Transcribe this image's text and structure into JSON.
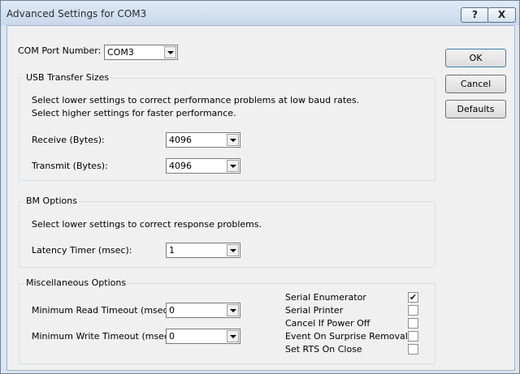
{
  "window": {
    "title": "Advanced Settings for COM3",
    "help_label": "?",
    "close_label": "X"
  },
  "com_port": {
    "label": "COM Port Number:",
    "value": "COM3"
  },
  "buttons": {
    "ok": "OK",
    "cancel": "Cancel",
    "defaults": "Defaults"
  },
  "usb": {
    "legend": "USB Transfer Sizes",
    "desc1": "Select lower settings to correct performance problems at low baud rates.",
    "desc2": "Select higher settings for faster performance.",
    "receive_label": "Receive (Bytes):",
    "receive_value": "4096",
    "transmit_label": "Transmit (Bytes):",
    "transmit_value": "4096"
  },
  "bm": {
    "legend": "BM Options",
    "desc": "Select lower settings to correct response problems.",
    "latency_label": "Latency Timer (msec):",
    "latency_value": "1"
  },
  "misc": {
    "legend": "Miscellaneous Options",
    "read_timeout_label": "Minimum Read Timeout (msec):",
    "read_timeout_value": "0",
    "write_timeout_label": "Minimum Write Timeout (msec):",
    "write_timeout_value": "0",
    "options": [
      {
        "label": "Serial Enumerator",
        "checked": true,
        "mark": "✔"
      },
      {
        "label": "Serial Printer",
        "checked": false,
        "mark": ""
      },
      {
        "label": "Cancel If Power Off",
        "checked": false,
        "mark": ""
      },
      {
        "label": "Event On Surprise Removal",
        "checked": false,
        "mark": ""
      },
      {
        "label": "Set RTS On Close",
        "checked": false,
        "mark": ""
      }
    ]
  }
}
